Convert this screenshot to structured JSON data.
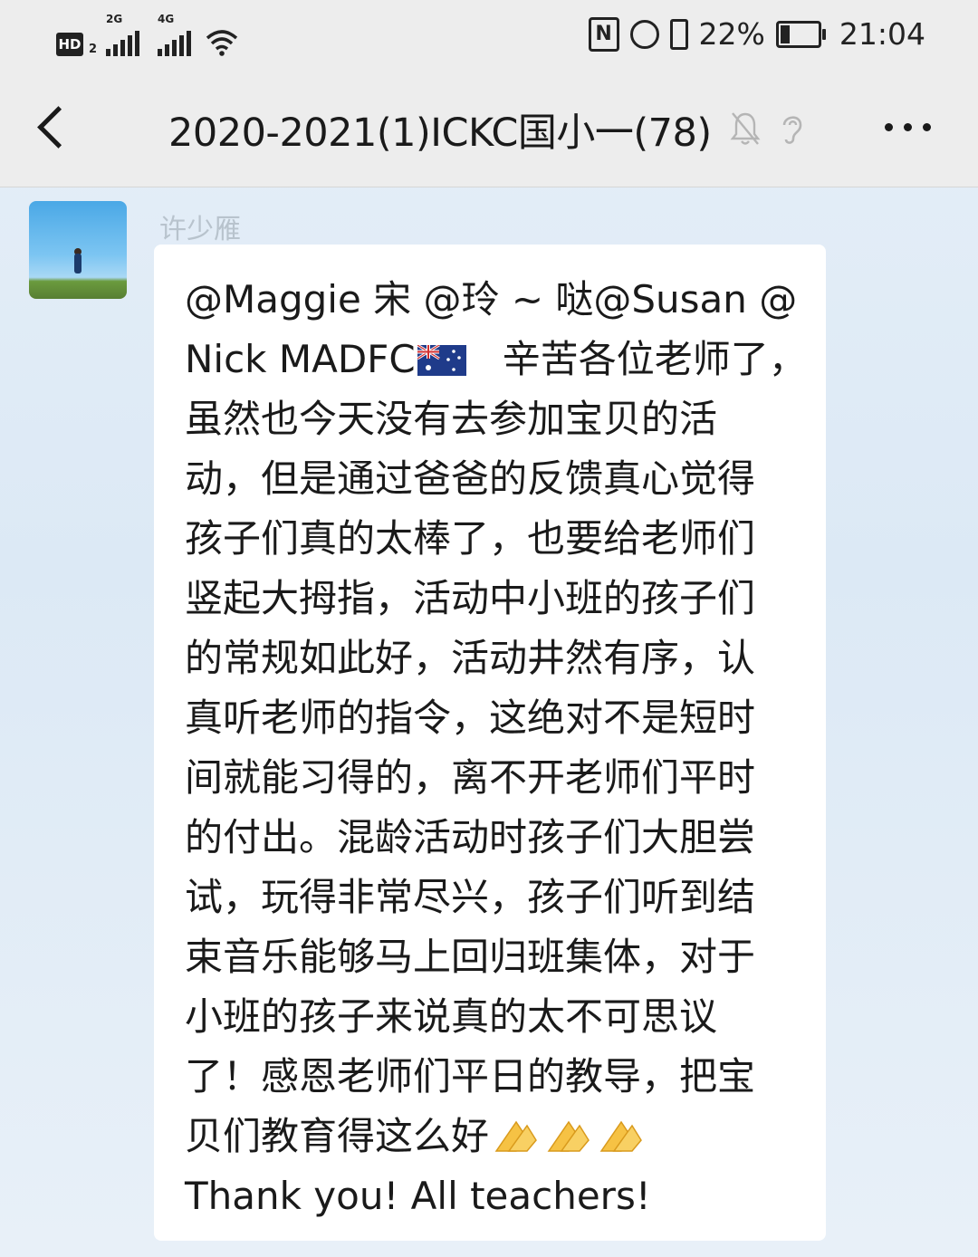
{
  "status_bar": {
    "hd_label": "HD",
    "hd_sub": "2",
    "signal1_label": "2G",
    "signal2_label": "4G",
    "nfc_label": "N",
    "battery_percent": "22%",
    "battery_level": 0.22,
    "time": "21:04"
  },
  "header": {
    "title": "2020-2021(1)ICKC国小一(78)"
  },
  "message": {
    "sender": "许少雁",
    "lines": [
      "@Maggie 宋  @玲 ~ 哒@Susan @",
      "Nick MADFC",
      "   辛苦各位老师了，",
      "虽然也今天没有去参加宝贝的活",
      "动，但是通过爸爸的反馈真心觉得",
      "孩子们真的太棒了，也要给老师们",
      "竖起大拇指，活动中小班的孩子们",
      "的常规如此好，活动井然有序，认",
      "真听老师的指令，这绝对不是短时",
      "间就能习得的，离不开老师们平时",
      "的付出。混龄活动时孩子们大胆尝",
      "试，玩得非常尽兴，孩子们听到结",
      "束音乐能够马上回归班集体，对于",
      "小班的孩子来说真的太不可思议",
      "了！感恩老师们平日的教导，把宝",
      "贝们教育得这么好",
      "Thank you! All teachers!"
    ]
  }
}
